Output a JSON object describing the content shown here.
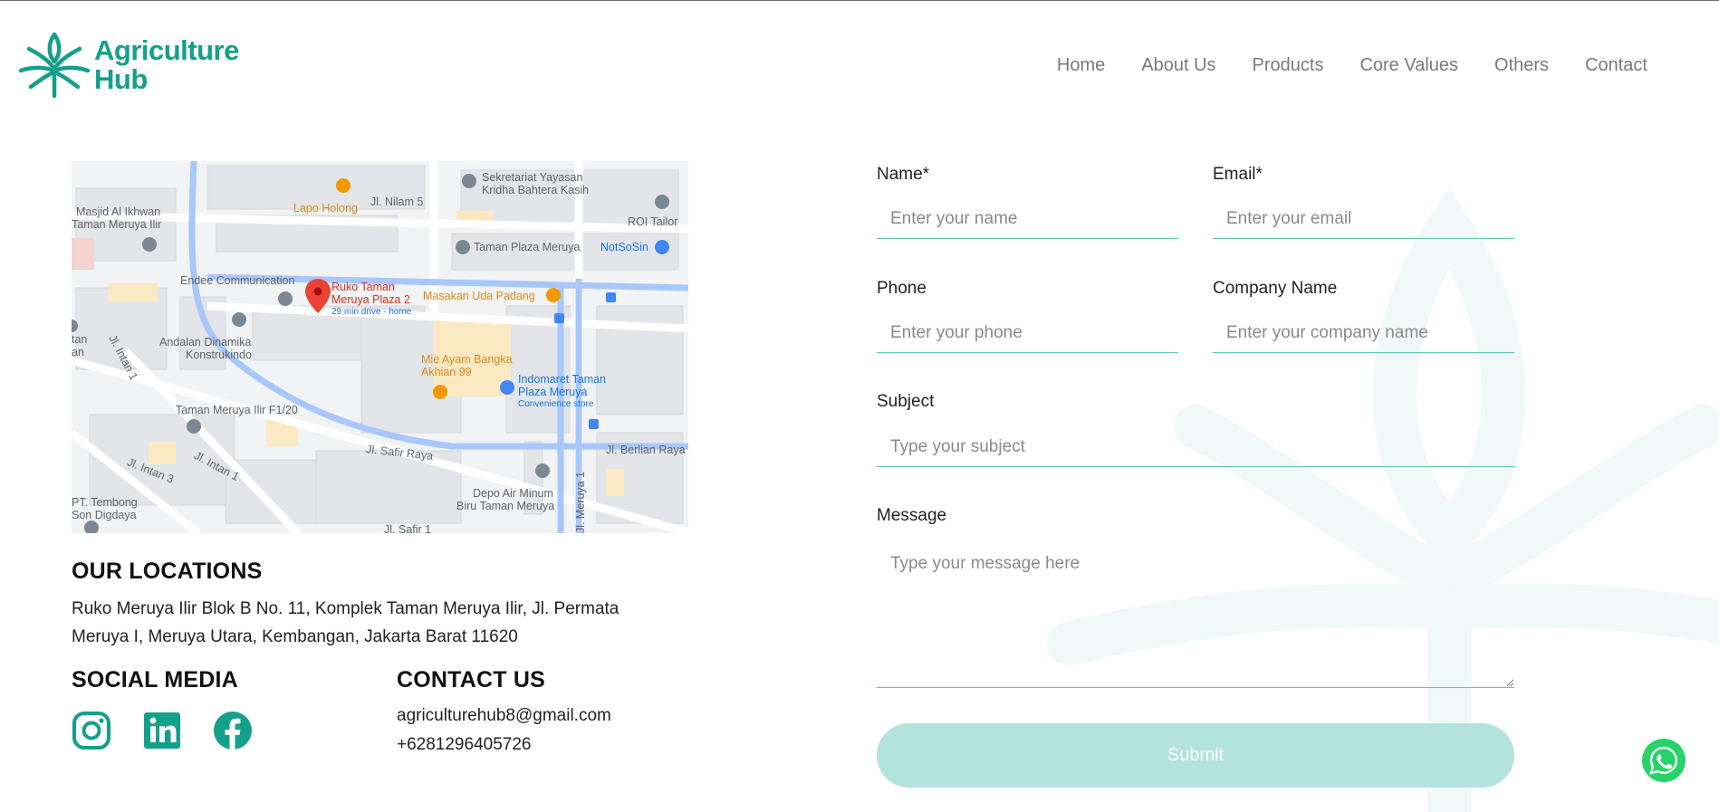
{
  "brand": {
    "line1": "Agriculture",
    "line2": "Hub",
    "color": "#14a08a"
  },
  "nav": [
    "Home",
    "About Us",
    "Products",
    "Core Values",
    "Others",
    "Contact"
  ],
  "map": {
    "labels": {
      "masjid": "Masjid Al Ikhwan",
      "taman_meruya_ilir": "Taman Meruya Ilir",
      "lapo": "Lapo Holong",
      "nilam": "Jl. Nilam 5",
      "sekretariat1": "Sekretariat Yayasan",
      "sekretariat2": "Kridha Bahtera Kasih",
      "roi": "ROI Tailor",
      "taman_plaza": "Taman Plaza Meruya",
      "notsosin": "NotSoSin",
      "endee": "Endee Communication",
      "ruko1": "Ruko Taman",
      "ruko2": "Meruya Plaza 2",
      "drive": "29 min drive - home",
      "masakan": "Masakan Uda Padang",
      "andalan1": "Andalan Dinamika",
      "andalan2": "Konstrukindo",
      "intan1": "Jl. Intan 1",
      "mie1": "Mie Ayam Bangka",
      "mie2": "Akhian 99",
      "indomaret1": "Indomaret Taman",
      "indomaret2": "Plaza Meruya",
      "indomaret3": "Convenience store",
      "taman_f120": "Taman Meruya Ilir F1/20",
      "safir": "Jl. Safir Raya",
      "berlian": "Jl. Berlian Raya",
      "intan3": "Jl. Intan 3",
      "intan1b": "Jl. Intan 1",
      "depo1": "Depo Air Minum",
      "depo2": "Biru Taman Meruya",
      "tembong1": "PT. Tembong",
      "tembong2": "Son Digdaya",
      "meruya1": "Jl. Meruya 1",
      "safir1": "Jl. Safir 1",
      "tan": "tan",
      "an": "an"
    }
  },
  "locations": {
    "heading": "OUR LOCATIONS",
    "address_line1": "Ruko Meruya Ilir Blok B No. 11, Komplek Taman Meruya Ilir, Jl. Permata",
    "address_line2": "Meruya I, Meruya Utara, Kembangan, Jakarta Barat 11620"
  },
  "social": {
    "heading": "SOCIAL MEDIA",
    "icons": [
      "instagram-icon",
      "linkedin-icon",
      "facebook-icon"
    ]
  },
  "contact": {
    "heading": "CONTACT US",
    "email": "agriculturehub8@gmail.com",
    "phone": "+6281296405726"
  },
  "form": {
    "name_label": "Name*",
    "name_placeholder": "Enter your name",
    "email_label": "Email*",
    "email_placeholder": "Enter your email",
    "phone_label": "Phone",
    "phone_placeholder": "Enter your phone",
    "company_label": "Company Name",
    "company_placeholder": "Enter your company name",
    "subject_label": "Subject",
    "subject_placeholder": "Type your subject",
    "message_label": "Message",
    "message_placeholder": "Type your message here",
    "submit_label": "Submit"
  },
  "colors": {
    "accent": "#14a08a",
    "field_line": "#5cc7b6",
    "submit_bg": "#b3e3dc",
    "whatsapp": "#25d366"
  }
}
